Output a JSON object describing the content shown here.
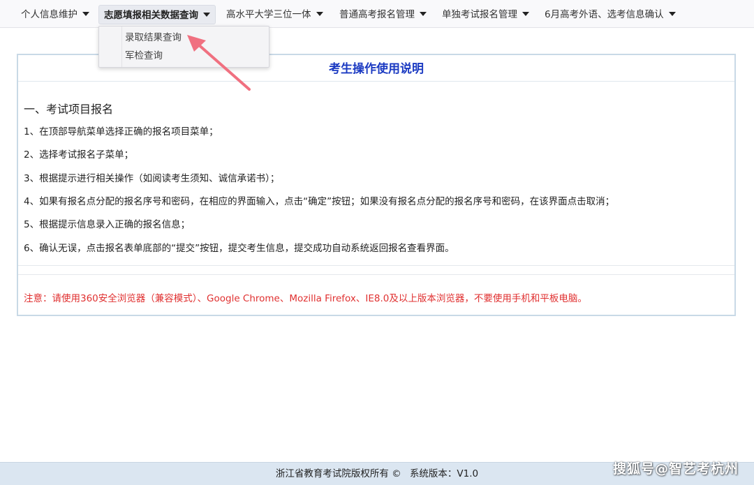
{
  "nav": {
    "items": [
      {
        "label": "个人信息维护"
      },
      {
        "label": "志愿填报相关数据查询"
      },
      {
        "label": "高水平大学三位一体"
      },
      {
        "label": "普通高考报名管理"
      },
      {
        "label": "单独考试报名管理"
      },
      {
        "label": "6月高考外语、选考信息确认"
      }
    ],
    "active_index": 1,
    "dropdown": [
      {
        "label": "录取结果查询"
      },
      {
        "label": "军检查询"
      }
    ]
  },
  "panel": {
    "title": "考生操作使用说明",
    "section_title": "一、考试项目报名",
    "steps": [
      "1、在顶部导航菜单选择正确的报名项目菜单；",
      "2、选择考试报名子菜单；",
      "3、根据提示进行相关操作（如阅读考生须知、诚信承诺书）；",
      "4、如果有报名点分配的报名序号和密码，在相应的界面输入，点击“确定”按钮；如果没有报名点分配的报名序号和密码，在该界面点击取消；",
      "5、根据提示信息录入正确的报名信息；",
      "6、确认无误，点击报名表单底部的“提交”按钮，提交考生信息，提交成功自动系统返回报名查看界面。"
    ],
    "notice": "注意：请使用360安全浏览器（兼容模式）、Google Chrome、Mozilla Firefox、IE8.0及以上版本浏览器，不要使用手机和平板电脑。"
  },
  "footer": {
    "copyright": "浙江省教育考试院版权所有 ©",
    "version": "系统版本：V1.0"
  },
  "watermark": "搜狐号@智艺考杭州",
  "colors": {
    "title_blue": "#1b3ac2",
    "notice_red": "#e03030",
    "arrow_pink": "#f07080",
    "footer_bg": "#dbe6f1"
  }
}
